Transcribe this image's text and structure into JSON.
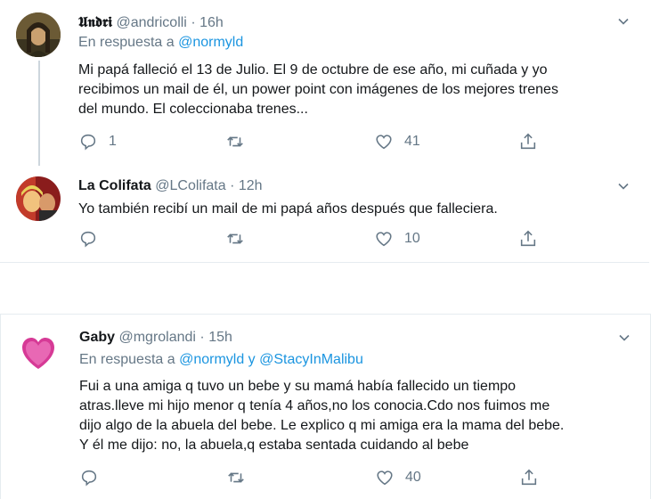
{
  "tweets": [
    {
      "display_name": "𝖀𝖓𝖉𝖗𝖎",
      "handle": "@andricolli",
      "time": "· 16h",
      "reply_prefix": "En respuesta a ",
      "reply_to": "@normyld",
      "text_lines": [
        "Mi papá falleció el 13 de Julio. El 9 de octubre de ese año, mi cuñada y yo",
        "recibimos un mail de él, un power point con imágenes de los mejores trenes",
        "del mundo. El coleccionaba trenes..."
      ],
      "reply_count": "1",
      "retweet_count": "",
      "like_count": "41"
    },
    {
      "display_name": "La Colifata",
      "handle": "@LColifata",
      "time": "· 12h",
      "text_lines": [
        "Yo también recibí un mail de mi papá años después que falleciera."
      ],
      "reply_count": "",
      "retweet_count": "",
      "like_count": "10"
    },
    {
      "display_name": "Gaby",
      "handle": "@mgrolandi",
      "time": "· 15h",
      "reply_prefix": "En respuesta a ",
      "reply_to": "@normyld y @StacyInMalibu",
      "text_lines": [
        "Fui a una amiga q tuvo un bebe y su mamá había fallecido un tiempo",
        "atras.lleve mi hijo menor q tenía 4 años,no los conocia.Cdo nos fuimos me",
        "dijo algo de la abuela del bebe. Le explico q mi amiga era la mama del bebe.",
        "Y él me dijo: no, la abuela,q estaba sentada cuidando al bebe"
      ],
      "reply_count": "",
      "retweet_count": "",
      "like_count": "40"
    }
  ],
  "colors": {
    "text": "#14171a",
    "secondary": "#657786",
    "link": "#1b95e0",
    "divider": "#e6ecf0"
  },
  "icons": [
    "reply-icon",
    "retweet-icon",
    "like-icon",
    "share-icon",
    "chevron-down-icon"
  ]
}
